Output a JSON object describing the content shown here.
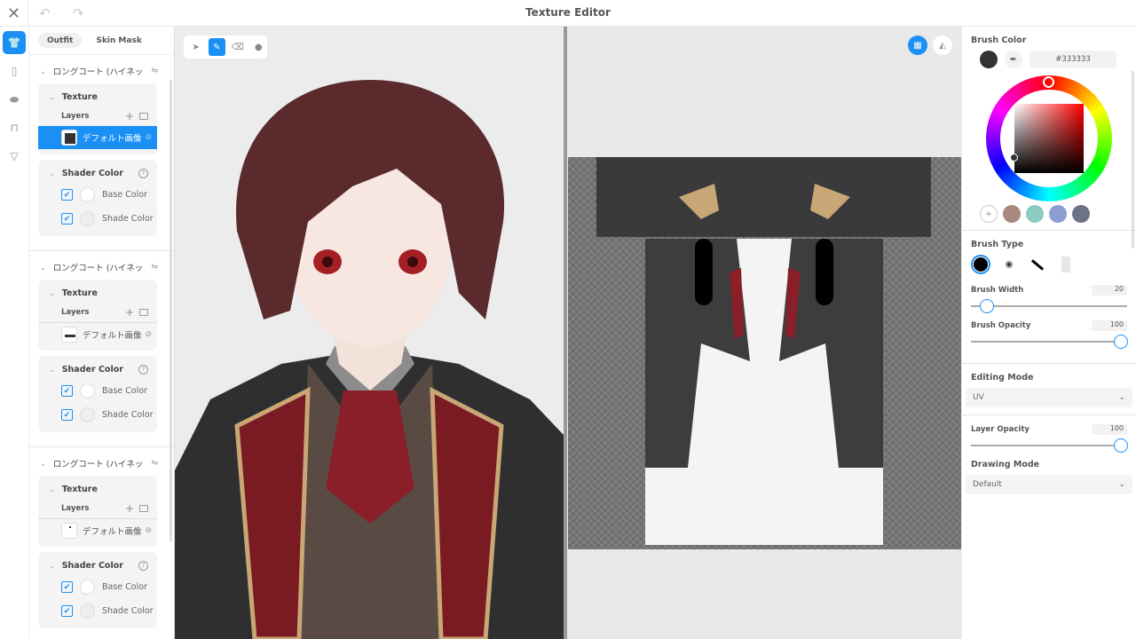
{
  "window": {
    "title": "Texture Editor"
  },
  "rail": {
    "items": [
      {
        "name": "outfit"
      },
      {
        "name": "bottoms"
      },
      {
        "name": "shoes"
      },
      {
        "name": "top"
      },
      {
        "name": "accessory"
      }
    ]
  },
  "sidebar": {
    "tabs": [
      {
        "label": "Outfit"
      },
      {
        "label": "Skin Mask"
      }
    ],
    "groups": [
      {
        "title": "ロングコート (ハイネッ",
        "texture_label": "Texture",
        "layers_label": "Layers",
        "layer_name": "デフォルト画像",
        "selected": true,
        "shader_label": "Shader Color",
        "base_label": "Base Color",
        "shade_label": "Shade Color"
      },
      {
        "title": "ロングコート (ハイネッ",
        "texture_label": "Texture",
        "layers_label": "Layers",
        "layer_name": "デフォルト画像",
        "selected": false,
        "shader_label": "Shader Color",
        "base_label": "Base Color",
        "shade_label": "Shade Color"
      },
      {
        "title": "ロングコート (ハイネッ",
        "texture_label": "Texture",
        "layers_label": "Layers",
        "layer_name": "デフォルト画像",
        "selected": false,
        "shader_label": "Shader Color",
        "base_label": "Base Color",
        "shade_label": "Shade Color"
      }
    ]
  },
  "toolbox": {
    "tools": [
      "select",
      "brush",
      "eraser",
      "fill"
    ],
    "active": "brush"
  },
  "uv_view": {
    "buttons": [
      "grid",
      "mirror"
    ],
    "active": "grid"
  },
  "right": {
    "brush_color_label": "Brush Color",
    "hex": "#333333",
    "current_color": "#333333",
    "presets": [
      "#a98880",
      "#8ccbc2",
      "#8c9dd3",
      "#6b7385"
    ],
    "brush_type_label": "Brush Type",
    "brush_width_label": "Brush Width",
    "brush_width": "20",
    "brush_opacity_label": "Brush Opacity",
    "brush_opacity": "100",
    "editing_mode_label": "Editing Mode",
    "editing_mode": "UV",
    "layer_opacity_label": "Layer Opacity",
    "layer_opacity": "100",
    "drawing_mode_label": "Drawing Mode",
    "drawing_mode": "Default"
  },
  "colors": {
    "accent": "#1a90f5"
  }
}
